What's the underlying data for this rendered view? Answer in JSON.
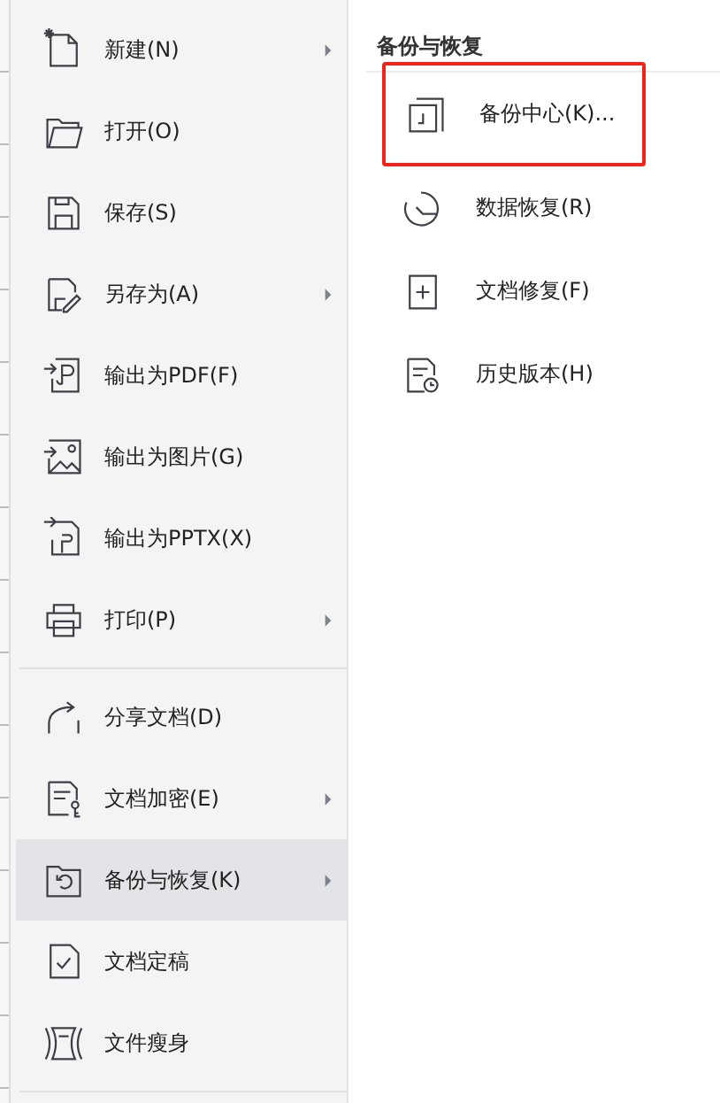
{
  "menu": {
    "groups": [
      [
        {
          "label": "新建(N)",
          "has_submenu": true,
          "selected": false
        },
        {
          "label": "打开(O)",
          "has_submenu": false,
          "selected": false
        },
        {
          "label": "保存(S)",
          "has_submenu": false,
          "selected": false
        },
        {
          "label": "另存为(A)",
          "has_submenu": true,
          "selected": false
        },
        {
          "label": "输出为PDF(F)",
          "has_submenu": false,
          "selected": false
        },
        {
          "label": "输出为图片(G)",
          "has_submenu": false,
          "selected": false
        },
        {
          "label": "输出为PPTX(X)",
          "has_submenu": false,
          "selected": false
        },
        {
          "label": "打印(P)",
          "has_submenu": true,
          "selected": false
        }
      ],
      [
        {
          "label": "分享文档(D)",
          "has_submenu": false,
          "selected": false
        },
        {
          "label": "文档加密(E)",
          "has_submenu": true,
          "selected": false
        },
        {
          "label": "备份与恢复(K)",
          "has_submenu": true,
          "selected": true
        },
        {
          "label": "文档定稿",
          "has_submenu": false,
          "selected": false
        },
        {
          "label": "文件瘦身",
          "has_submenu": false,
          "selected": false
        }
      ]
    ]
  },
  "submenu": {
    "title": "备份与恢复",
    "items": [
      {
        "label": "备份中心(K)...",
        "highlighted": true
      },
      {
        "label": "数据恢复(R)",
        "highlighted": false
      },
      {
        "label": "文档修复(F)",
        "highlighted": false
      },
      {
        "label": "历史版本(H)",
        "highlighted": false
      }
    ]
  }
}
